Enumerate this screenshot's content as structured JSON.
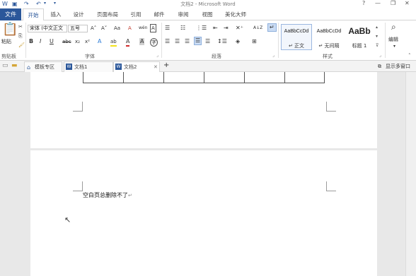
{
  "window": {
    "title": "文档2 - Microsoft Word",
    "controls": [
      "?",
      "—",
      "❐",
      "✕"
    ]
  },
  "ribbon_tabs": {
    "file": "文件",
    "tabs": [
      "开始",
      "插入",
      "设计",
      "页面布局",
      "引用",
      "邮件",
      "审阅",
      "视图",
      "美化大师"
    ],
    "active": "开始"
  },
  "clipboard": {
    "paste_label": "粘贴",
    "group_label": "剪贴板"
  },
  "font": {
    "family_value": "宋体 (中文正文",
    "size_value": "五号",
    "grow": "A˄",
    "shrink": "A˅",
    "case": "Aa",
    "clear_format": "A",
    "pinyin": "wén",
    "char_border": "A",
    "bold": "B",
    "italic": "I",
    "underline": "U",
    "strike": "abc",
    "subscript": "x₂",
    "superscript": "x²",
    "text_effect": "A",
    "highlight": "ab",
    "font_color": "A",
    "char_shade": "A",
    "enclose": "字",
    "group_label": "字体"
  },
  "paragraph": {
    "group_label": "段落",
    "sort": "A↓Z",
    "show_marks": "↵"
  },
  "styles": {
    "group_label": "样式",
    "items": [
      {
        "sample": "AaBbCcDd",
        "name": "↵ 正文"
      },
      {
        "sample": "AaBbCcDd",
        "name": "↵ 无间隔"
      },
      {
        "sample": "AaBb",
        "name": "标题 1"
      }
    ]
  },
  "editing": {
    "label": "编辑"
  },
  "doc_tabs": {
    "template": "模板专区",
    "doc1": "文档1",
    "doc2": "文档2",
    "add": "+",
    "show_more": "显示多窗口"
  },
  "document": {
    "body_text": "空白页总删除不了",
    "para_mark": "↵"
  },
  "colors": {
    "accent": "#2b579a",
    "workspace": "#e8e8e8"
  }
}
